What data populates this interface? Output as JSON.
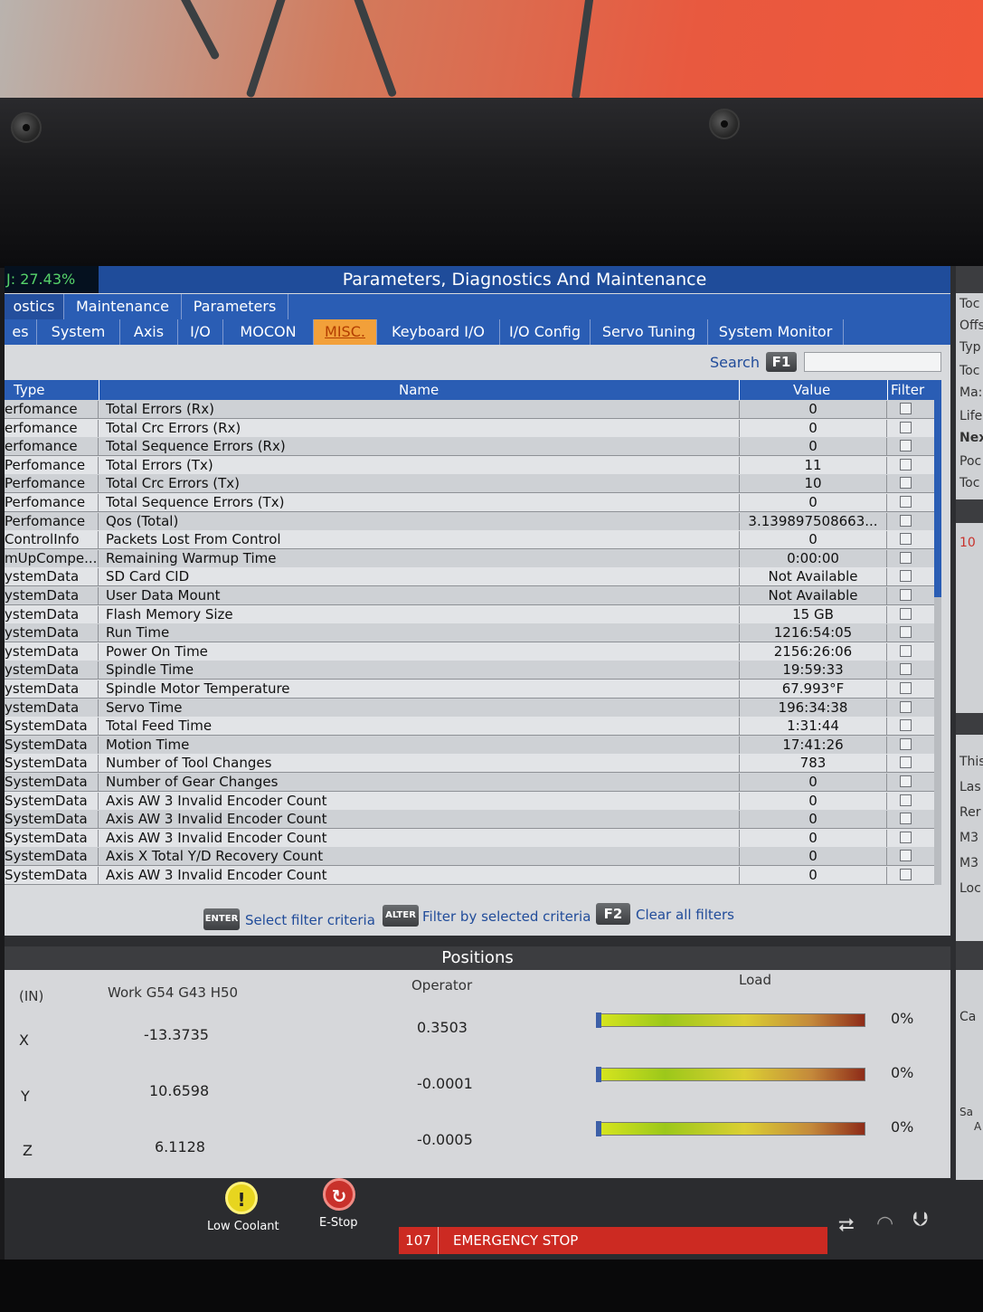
{
  "header": {
    "utilization": "J: 27.43%",
    "title": "Parameters, Diagnostics And Maintenance"
  },
  "tabs_level1": [
    "ostics",
    "Maintenance",
    "Parameters"
  ],
  "tabs_level2": [
    "es",
    "System",
    "Axis",
    "I/O",
    "MOCON",
    "MISC.",
    "Keyboard I/O",
    "I/O Config",
    "Servo Tuning",
    "System Monitor"
  ],
  "active_tab": "MISC.",
  "search": {
    "label": "Search",
    "key": "F1",
    "value": ""
  },
  "table": {
    "columns": [
      "Type",
      "Name",
      "Value",
      "Filter"
    ],
    "rows": [
      {
        "type": "erfomance",
        "name": "Total Errors (Rx)",
        "value": "0"
      },
      {
        "type": "erfomance",
        "name": "Total Crc Errors (Rx)",
        "value": "0"
      },
      {
        "type": "erfomance",
        "name": "Total Sequence Errors (Rx)",
        "value": "0"
      },
      {
        "type": "Perfomance",
        "name": "Total Errors (Tx)",
        "value": "11"
      },
      {
        "type": "Perfomance",
        "name": "Total Crc Errors (Tx)",
        "value": "10"
      },
      {
        "type": "Perfomance",
        "name": "Total Sequence Errors (Tx)",
        "value": "0"
      },
      {
        "type": "Perfomance",
        "name": "Qos (Total)",
        "value": "3.139897508663..."
      },
      {
        "type": "ControlInfo",
        "name": "Packets Lost From Control",
        "value": "0"
      },
      {
        "type": "mUpCompe...",
        "name": "Remaining Warmup Time",
        "value": "0:00:00"
      },
      {
        "type": "ystemData",
        "name": "SD Card CID",
        "value": "Not Available"
      },
      {
        "type": "ystemData",
        "name": "User Data Mount",
        "value": "Not Available"
      },
      {
        "type": "ystemData",
        "name": "Flash Memory Size",
        "value": "15 GB"
      },
      {
        "type": "ystemData",
        "name": "Run Time",
        "value": "1216:54:05"
      },
      {
        "type": "ystemData",
        "name": "Power On Time",
        "value": "2156:26:06"
      },
      {
        "type": "ystemData",
        "name": "Spindle Time",
        "value": "19:59:33"
      },
      {
        "type": "ystemData",
        "name": "Spindle Motor Temperature",
        "value": "67.993°F"
      },
      {
        "type": "ystemData",
        "name": "Servo Time",
        "value": "196:34:38"
      },
      {
        "type": "SystemData",
        "name": "Total Feed Time",
        "value": "1:31:44"
      },
      {
        "type": "SystemData",
        "name": "Motion Time",
        "value": "17:41:26"
      },
      {
        "type": "SystemData",
        "name": "Number of Tool Changes",
        "value": "783"
      },
      {
        "type": "SystemData",
        "name": "Number of Gear Changes",
        "value": "0"
      },
      {
        "type": "SystemData",
        "name": "Axis AW 3 Invalid Encoder Count",
        "value": "0"
      },
      {
        "type": "SystemData",
        "name": "Axis AW 3 Invalid Encoder Count",
        "value": "0"
      },
      {
        "type": "SystemData",
        "name": "Axis AW 3 Invalid Encoder Count",
        "value": "0"
      },
      {
        "type": "SystemData",
        "name": "Axis X Total Y/D Recovery Count",
        "value": "0"
      },
      {
        "type": "SystemData",
        "name": "Axis AW 3 Invalid Encoder Count",
        "value": "0"
      },
      {
        "type": "SystemData",
        "name": "Axis AW 3 Invalid Encoder Count",
        "value": "0"
      }
    ]
  },
  "hints": {
    "enter_key": "ENTER",
    "enter_label": "Select filter criteria",
    "alter_key": "ALTER",
    "alter_label": "Filter by selected criteria",
    "f2_key": "F2",
    "f2_label": "Clear all filters"
  },
  "positions": {
    "title": "Positions",
    "units": "(IN)",
    "work_label": "Work G54 G43 H50",
    "operator_label": "Operator",
    "load_label": "Load",
    "axes": [
      {
        "axis": "X",
        "work": "-13.3735",
        "operator": "0.3503",
        "load": "0%",
        "load_fraction": 0.0
      },
      {
        "axis": "Y",
        "work": "10.6598",
        "operator": "-0.0001",
        "load": "0%",
        "load_fraction": 0.0
      },
      {
        "axis": "Z",
        "work": "6.1128",
        "operator": "-0.0005",
        "load": "0%",
        "load_fraction": 0.0
      }
    ]
  },
  "status": {
    "low_coolant_label": "Low Coolant",
    "estop_label": "E-Stop",
    "alarm_code": "107",
    "alarm_message": "EMERGENCY STOP"
  },
  "side_panel": {
    "items_top": [
      "Toc",
      "Offs",
      "Typ",
      "Toc",
      "Ma:",
      "Life",
      "Nex",
      "Poc",
      "Toc"
    ],
    "value_red": "10",
    "items_bottom": [
      "This",
      "Las",
      "Rer",
      "M3",
      "M3",
      "Loc"
    ],
    "misc": [
      "Ca",
      "Sa",
      "A"
    ]
  },
  "colors": {
    "title_bar": "#1f4c9a",
    "tab_bar": "#2a5db4",
    "active_tab": "#f2a03a",
    "alarm": "#cc2a22"
  }
}
